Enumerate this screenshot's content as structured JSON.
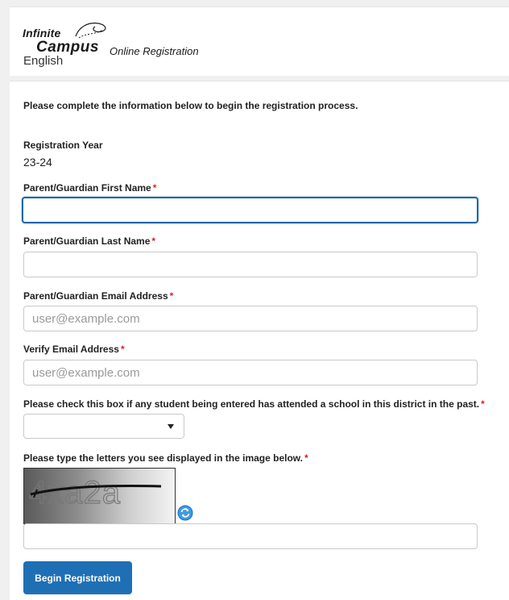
{
  "header": {
    "logo_line1": "Infinite",
    "logo_line2": "Campus",
    "logo_subtitle": "Online Registration",
    "language": "English"
  },
  "form": {
    "intro": "Please complete the information below to begin the registration process.",
    "year_label": "Registration Year",
    "year_value": "23-24",
    "first_name_label": "Parent/Guardian First Name",
    "first_name_value": "",
    "last_name_label": "Parent/Guardian Last Name",
    "last_name_value": "",
    "email_label": "Parent/Guardian Email Address",
    "email_placeholder": "user@example.com",
    "verify_email_label": "Verify Email Address",
    "verify_email_placeholder": "user@example.com",
    "attended_label": "Please check this box if any student being entered has attended a school in this district in the past.",
    "attended_selected": "",
    "captcha_label": "Please type the letters you see displayed in the image below.",
    "captcha_text": "4xa2a",
    "captcha_value": "",
    "required_marker": "*",
    "submit_label": "Begin Registration"
  },
  "colors": {
    "accent": "#1f6fb5",
    "focus_border": "#2166a8",
    "required": "#e02020",
    "page_bg": "#f0f0f0"
  },
  "icons": {
    "refresh": "refresh-icon"
  }
}
